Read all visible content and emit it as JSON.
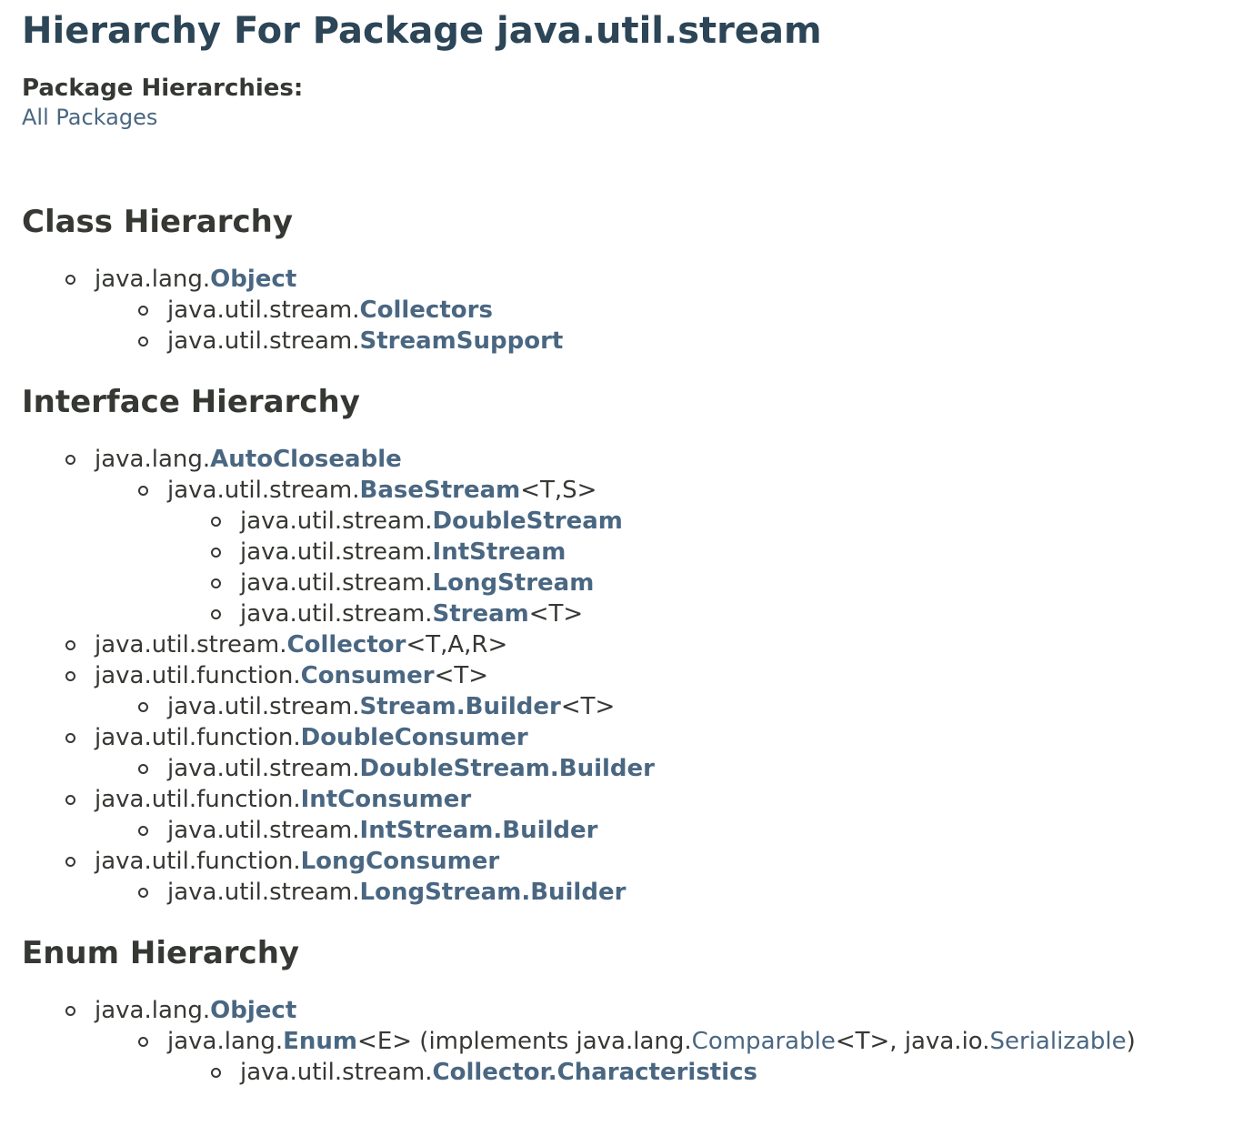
{
  "title": "Hierarchy For Package java.util.stream",
  "package_hierarchies": {
    "label": "Package Hierarchies:",
    "link": "All Packages"
  },
  "sections": {
    "class": {
      "heading": "Class Hierarchy",
      "items": [
        {
          "prefix": "java.lang.",
          "name": "Object",
          "suffix": ""
        },
        {
          "prefix": "java.util.stream.",
          "name": "Collectors",
          "suffix": ""
        },
        {
          "prefix": "java.util.stream.",
          "name": "StreamSupport",
          "suffix": ""
        }
      ]
    },
    "interface": {
      "heading": "Interface Hierarchy",
      "items": [
        {
          "prefix": "java.lang.",
          "name": "AutoCloseable",
          "suffix": ""
        },
        {
          "prefix": "java.util.stream.",
          "name": "BaseStream",
          "suffix": "<T,S>"
        },
        {
          "prefix": "java.util.stream.",
          "name": "DoubleStream",
          "suffix": ""
        },
        {
          "prefix": "java.util.stream.",
          "name": "IntStream",
          "suffix": ""
        },
        {
          "prefix": "java.util.stream.",
          "name": "LongStream",
          "suffix": ""
        },
        {
          "prefix": "java.util.stream.",
          "name": "Stream",
          "suffix": "<T>"
        },
        {
          "prefix": "java.util.stream.",
          "name": "Collector",
          "suffix": "<T,A,R>"
        },
        {
          "prefix": "java.util.function.",
          "name": "Consumer",
          "suffix": "<T>"
        },
        {
          "prefix": "java.util.stream.",
          "name": "Stream.Builder",
          "suffix": "<T>"
        },
        {
          "prefix": "java.util.function.",
          "name": "DoubleConsumer",
          "suffix": ""
        },
        {
          "prefix": "java.util.stream.",
          "name": "DoubleStream.Builder",
          "suffix": ""
        },
        {
          "prefix": "java.util.function.",
          "name": "IntConsumer",
          "suffix": ""
        },
        {
          "prefix": "java.util.stream.",
          "name": "IntStream.Builder",
          "suffix": ""
        },
        {
          "prefix": "java.util.function.",
          "name": "LongConsumer",
          "suffix": ""
        },
        {
          "prefix": "java.util.stream.",
          "name": "LongStream.Builder",
          "suffix": ""
        }
      ]
    },
    "enum": {
      "heading": "Enum Hierarchy",
      "items": [
        {
          "prefix": "java.lang.",
          "name": "Object",
          "suffix": ""
        },
        {
          "prefix": "java.lang.",
          "name": "Enum",
          "suffix": "<E> (implements java.lang.",
          "link2": "Comparable",
          "mid": "<T>, java.io.",
          "link3": "Serializable",
          "end": ")"
        },
        {
          "prefix": "java.util.stream.",
          "name": "Collector.Characteristics",
          "suffix": ""
        }
      ]
    }
  }
}
